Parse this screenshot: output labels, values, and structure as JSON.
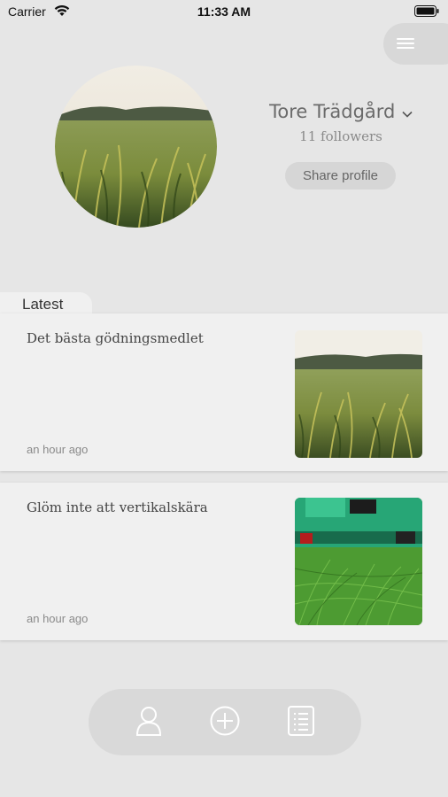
{
  "status_bar": {
    "carrier": "Carrier",
    "time": "11:33 AM",
    "icons": [
      "wifi-icon",
      "battery-icon"
    ]
  },
  "header": {
    "menu_icon": "hamburger-menu-icon"
  },
  "profile": {
    "name": "Tore Trädgård",
    "followers": "11 followers",
    "share_label": "Share profile"
  },
  "feed": {
    "section_label": "Latest",
    "posts": [
      {
        "title": "Det bästa gödningsmedlet",
        "time": "an hour ago",
        "image": "grass-closeup"
      },
      {
        "title": "Glöm inte att vertikalskära",
        "time": "an hour ago",
        "image": "lawn-mower-grass"
      }
    ]
  },
  "tab_bar": {
    "items": [
      "profile-icon",
      "add-circle-icon",
      "list-icon"
    ]
  },
  "colors": {
    "background": "#e6e6e6",
    "card": "#f0f0f0",
    "pill": "#d8d8d8",
    "icon": "#ffffff"
  }
}
